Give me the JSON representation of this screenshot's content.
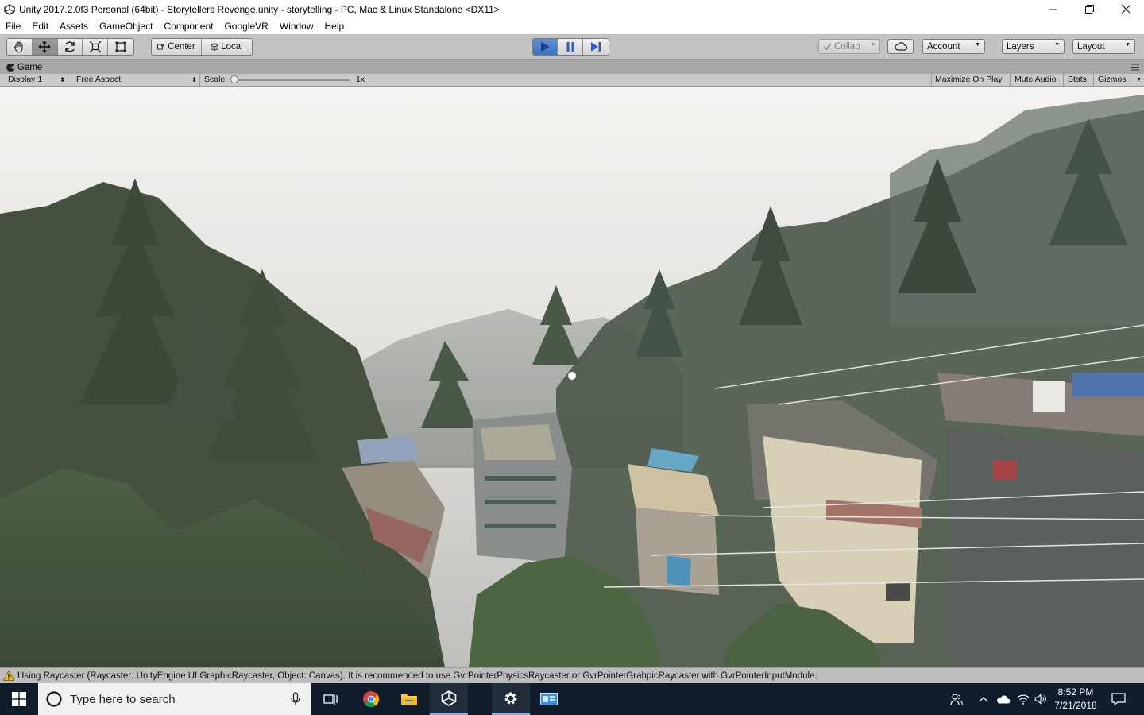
{
  "window": {
    "title": "Unity 2017.2.0f3 Personal (64bit) - Storytellers Revenge.unity - storytelling - PC, Mac & Linux Standalone <DX11>"
  },
  "menu": [
    "File",
    "Edit",
    "Assets",
    "GameObject",
    "Component",
    "GoogleVR",
    "Window",
    "Help"
  ],
  "toolbar": {
    "pivot_label": "Center",
    "space_label": "Local",
    "collab_label": "Collab",
    "account_label": "Account",
    "layers_label": "Layers",
    "layout_label": "Layout"
  },
  "game_view": {
    "tab_label": "Game",
    "display_label": "Display 1",
    "aspect_label": "Free Aspect",
    "scale_label": "Scale",
    "scale_value": "1x",
    "maximize_label": "Maximize On Play",
    "mute_label": "Mute Audio",
    "stats_label": "Stats",
    "gizmos_label": "Gizmos"
  },
  "status": {
    "message": "Using Raycaster (Raycaster: UnityEngine.UI.GraphicRaycaster, Object: Canvas). It is recommended to use GvrPointerPhysicsRaycaster or GvrPointerGrahpicRaycaster with GvrPointerInputModule."
  },
  "taskbar": {
    "search_placeholder": "Type here to search",
    "time": "8:52 PM",
    "date": "7/21/2018"
  },
  "colors": {
    "toolbar_bg": "#c2c2c2",
    "play_active": "#3f74c4",
    "taskbar_bg": "#101b2b"
  }
}
